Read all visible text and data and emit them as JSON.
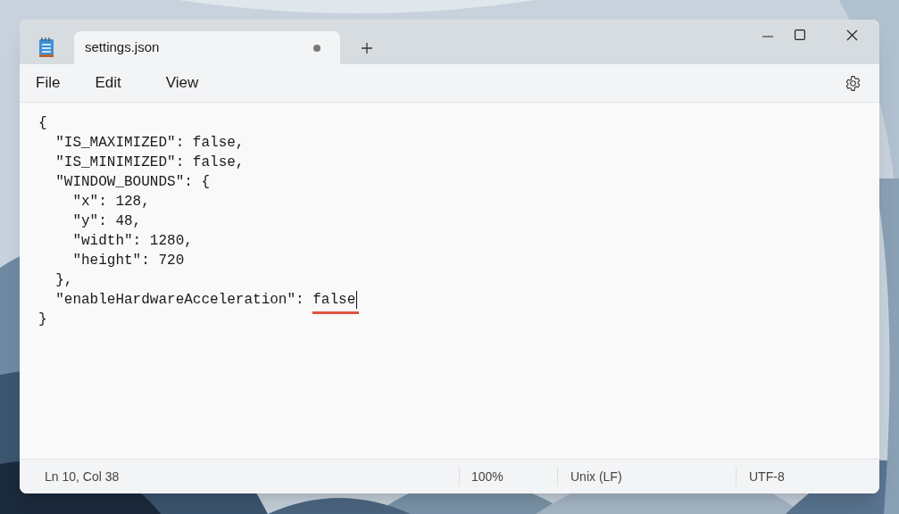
{
  "tab": {
    "title": "settings.json",
    "modified": true
  },
  "menu": [
    "File",
    "Edit",
    "View"
  ],
  "editor": {
    "lines": [
      {
        "parts": [
          {
            "text": "{"
          }
        ]
      },
      {
        "parts": [
          {
            "text": "  \"IS_MAXIMIZED\": false,"
          }
        ]
      },
      {
        "parts": [
          {
            "text": "  \"IS_MINIMIZED\": false,"
          }
        ]
      },
      {
        "parts": [
          {
            "text": "  \"WINDOW_BOUNDS\": {"
          }
        ]
      },
      {
        "parts": [
          {
            "text": "    \"x\": 128,"
          }
        ]
      },
      {
        "parts": [
          {
            "text": "    \"y\": 48,"
          }
        ]
      },
      {
        "parts": [
          {
            "text": "    \"width\": 1280,"
          }
        ]
      },
      {
        "parts": [
          {
            "text": "    \"height\": 720"
          }
        ]
      },
      {
        "parts": [
          {
            "text": "  },"
          }
        ]
      },
      {
        "parts": [
          {
            "text": "  \"enableHardwareAcceleration\": "
          },
          {
            "text": "false",
            "underlined": true,
            "caret": true
          }
        ]
      },
      {
        "parts": [
          {
            "text": "}"
          }
        ]
      }
    ]
  },
  "status_bar": {
    "position": "Ln 10, Col 38",
    "zoom": "100%",
    "line_ending": "Unix (LF)",
    "encoding": "UTF-8"
  }
}
